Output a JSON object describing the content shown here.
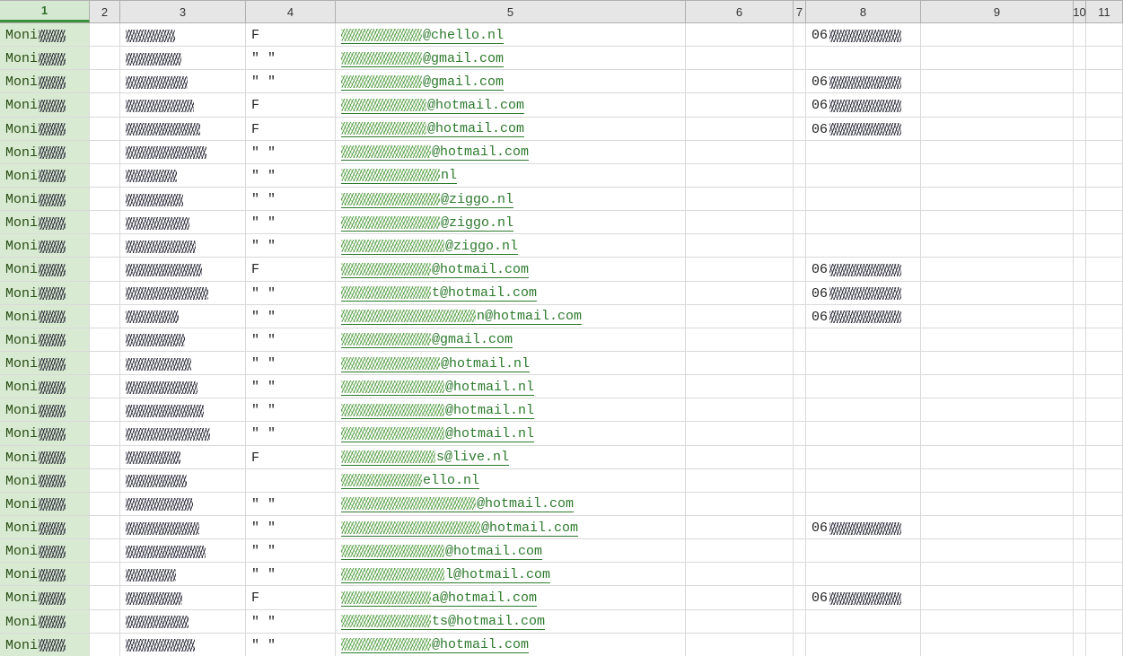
{
  "columns": [
    {
      "id": "1",
      "label": "1",
      "selected": true
    },
    {
      "id": "2",
      "label": "2"
    },
    {
      "id": "3",
      "label": "3"
    },
    {
      "id": "4",
      "label": "4"
    },
    {
      "id": "5",
      "label": "5"
    },
    {
      "id": "6",
      "label": "6"
    },
    {
      "id": "7",
      "label": "7"
    },
    {
      "id": "8",
      "label": "8"
    },
    {
      "id": "9",
      "label": "9"
    },
    {
      "id": "10",
      "label": "10"
    },
    {
      "id": "11",
      "label": "11"
    }
  ],
  "rows": [
    {
      "c1_pre": "Moni",
      "c3_redact": true,
      "c4": "F",
      "c5_suffix": "@chello.nl",
      "c5_redact_w": 90,
      "c8_pre": "06",
      "c8_redact": true
    },
    {
      "c1_pre": "Moni",
      "c3_redact": true,
      "c4": "\" \"",
      "c5_suffix": "@gmail.com",
      "c5_redact_w": 90,
      "c8_pre": "",
      "c8_redact": false
    },
    {
      "c1_pre": "Moni",
      "c3_redact": true,
      "c4": "\" \"",
      "c5_suffix": "@gmail.com",
      "c5_redact_w": 90,
      "c8_pre": "06",
      "c8_redact": true
    },
    {
      "c1_pre": "Moni",
      "c3_redact": true,
      "c4": "F",
      "c5_suffix": "@hotmail.com",
      "c5_redact_w": 95,
      "c8_pre": "06",
      "c8_redact": true
    },
    {
      "c1_pre": "Moni",
      "c3_redact": true,
      "c4": "F",
      "c5_suffix": "@hotmail.com",
      "c5_redact_w": 95,
      "c8_pre": "06",
      "c8_redact": true
    },
    {
      "c1_pre": "Moni",
      "c3_redact": true,
      "c4": "\" \"",
      "c5_suffix": "@hotmail.com",
      "c5_redact_w": 100,
      "c8_pre": "",
      "c8_redact": false
    },
    {
      "c1_pre": "Moni",
      "c3_redact": true,
      "c4": "\" \"",
      "c5_suffix": "nl",
      "c5_redact_w": 110,
      "c8_pre": "",
      "c8_redact": false
    },
    {
      "c1_pre": "Moni",
      "c3_redact": true,
      "c4": "\" \"",
      "c5_suffix": "@ziggo.nl",
      "c5_redact_w": 110,
      "c8_pre": "",
      "c8_redact": false
    },
    {
      "c1_pre": "Moni",
      "c3_redact": true,
      "c4": "\" \"",
      "c5_suffix": "@ziggo.nl",
      "c5_redact_w": 110,
      "c8_pre": "",
      "c8_redact": false
    },
    {
      "c1_pre": "Moni",
      "c3_redact": true,
      "c4": "\" \"",
      "c5_suffix": "@ziggo.nl",
      "c5_redact_w": 115,
      "c8_pre": "",
      "c8_redact": false
    },
    {
      "c1_pre": "Moni",
      "c3_redact": true,
      "c4": "F",
      "c5_suffix": "@hotmail.com",
      "c5_redact_w": 100,
      "c8_pre": "06",
      "c8_redact": true
    },
    {
      "c1_pre": "Moni",
      "c3_redact": true,
      "c4": "\" \"",
      "c5_suffix": "t@hotmail.com",
      "c5_redact_w": 100,
      "c8_pre": "06",
      "c8_redact": true
    },
    {
      "c1_pre": "Moni",
      "c3_redact": true,
      "c4": "\" \"",
      "c5_suffix": "n@hotmail.com",
      "c5_redact_w": 150,
      "c8_pre": "06",
      "c8_redact": true
    },
    {
      "c1_pre": "Moni",
      "c3_redact": true,
      "c4": "\" \"",
      "c5_suffix": "@gmail.com",
      "c5_redact_w": 100,
      "c8_pre": "",
      "c8_redact": false
    },
    {
      "c1_pre": "Moni",
      "c3_redact": true,
      "c4": "\" \"",
      "c5_suffix": "@hotmail.nl",
      "c5_redact_w": 110,
      "c8_pre": "",
      "c8_redact": false
    },
    {
      "c1_pre": "Moni",
      "c3_redact": true,
      "c4": "\" \"",
      "c5_suffix": "@hotmail.nl",
      "c5_redact_w": 115,
      "c8_pre": "",
      "c8_redact": false
    },
    {
      "c1_pre": "Moni",
      "c3_redact": true,
      "c4": "\" \"",
      "c5_suffix": "@hotmail.nl",
      "c5_redact_w": 115,
      "c8_pre": "",
      "c8_redact": false
    },
    {
      "c1_pre": "Moni",
      "c3_redact": true,
      "c4": "\" \"",
      "c5_suffix": "@hotmail.nl",
      "c5_redact_w": 115,
      "c8_pre": "",
      "c8_redact": false
    },
    {
      "c1_pre": "Moni",
      "c3_redact": true,
      "c4": "F",
      "c5_suffix": "s@live.nl",
      "c5_redact_w": 105,
      "c8_pre": "",
      "c8_redact": false
    },
    {
      "c1_pre": "Moni",
      "c3_redact": true,
      "c4": "",
      "c5_suffix": "ello.nl",
      "c5_redact_w": 90,
      "c8_pre": "",
      "c8_redact": false
    },
    {
      "c1_pre": "Moni",
      "c3_redact": true,
      "c4": "\" \"",
      "c5_suffix": "@hotmail.com",
      "c5_redact_w": 150,
      "c8_pre": "",
      "c8_redact": false
    },
    {
      "c1_pre": "Moni",
      "c3_redact": true,
      "c4": "\" \"",
      "c5_suffix": "@hotmail.com",
      "c5_redact_w": 155,
      "c8_pre": "06",
      "c8_redact": true
    },
    {
      "c1_pre": "Moni",
      "c3_redact": true,
      "c4": "\" \"",
      "c5_suffix": "@hotmail.com",
      "c5_redact_w": 115,
      "c8_pre": "",
      "c8_redact": false
    },
    {
      "c1_pre": "Moni",
      "c3_redact": true,
      "c4": "\" \"",
      "c5_suffix": "l@hotmail.com",
      "c5_redact_w": 115,
      "c8_pre": "",
      "c8_redact": false
    },
    {
      "c1_pre": "Moni",
      "c3_redact": true,
      "c4": "F",
      "c5_suffix": "a@hotmail.com",
      "c5_redact_w": 100,
      "c8_pre": "06",
      "c8_redact": true
    },
    {
      "c1_pre": "Moni",
      "c3_redact": true,
      "c4": "\" \"",
      "c5_suffix": "ts@hotmail.com",
      "c5_redact_w": 100,
      "c8_pre": "",
      "c8_redact": false
    },
    {
      "c1_pre": "Moni",
      "c3_redact": true,
      "c4": "\" \"",
      "c5_suffix": "@hotmail.com",
      "c5_redact_w": 100,
      "c8_pre": "",
      "c8_redact": false
    }
  ]
}
